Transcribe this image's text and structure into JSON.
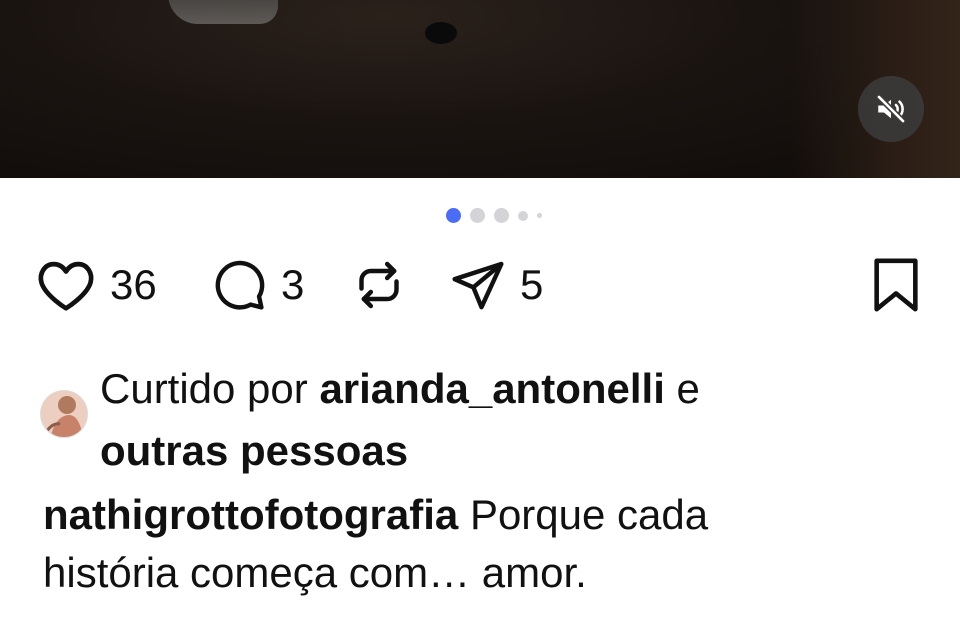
{
  "media": {
    "mute_icon": "speaker-muted-icon",
    "carousel": {
      "count": 5,
      "active_index": 0
    }
  },
  "actions": {
    "like_count": "36",
    "comment_count": "3",
    "share_count": "5",
    "icons": [
      "heart-icon",
      "comment-bubble-icon",
      "repost-icon",
      "send-icon",
      "bookmark-icon"
    ]
  },
  "liked_by": {
    "prefix": "Curtido por",
    "user": "arianda_antonelli",
    "conjunction": "e",
    "others": "outras pessoas"
  },
  "caption": {
    "username": "nathigrottofotografia",
    "line1": "Porque cada",
    "line2": "história começa com… amor."
  },
  "colors": {
    "accent": "#4a6cf7",
    "inactive_dot": "#d4d4d8",
    "text": "#111111"
  }
}
